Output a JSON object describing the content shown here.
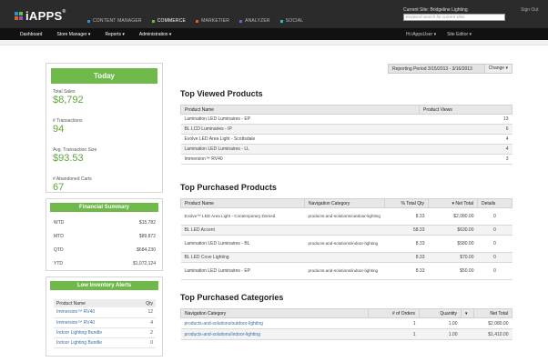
{
  "header": {
    "logo_text": "iAPPS",
    "logo_mark": "®",
    "modules": [
      {
        "label": "CONTENT MANAGER",
        "color": "#2f8fd8",
        "active": false
      },
      {
        "label": "COMMERCE",
        "color": "#6fb84a",
        "active": true
      },
      {
        "label": "MARKETIER",
        "color": "#e0622a",
        "active": false
      },
      {
        "label": "ANALYZER",
        "color": "#8a5ab8",
        "active": false
      },
      {
        "label": "SOCIAL",
        "color": "#2fb8c8",
        "active": false
      }
    ],
    "current_site": "Current Site: Bridgeline Lighting",
    "sign_out": "Sign Out",
    "search_placeholder": "Keyword search for current sites"
  },
  "nav": {
    "items": [
      "Dashboard",
      "Store Manager ▾",
      "Reports ▾",
      "Administration ▾"
    ],
    "right_items": [
      "Hi iAppsUser ▾",
      "Site Editor ▾"
    ]
  },
  "today": {
    "title": "Today",
    "stats": [
      {
        "label": "Total Sales",
        "value": "$8,792"
      },
      {
        "label": "# Transactions",
        "value": "94"
      },
      {
        "label": "Avg. Transaction Size",
        "value": "$93.53"
      },
      {
        "label": "# Abandoned Carts",
        "value": "67"
      }
    ]
  },
  "financial_summary": {
    "title": "Financial Summary",
    "rows": [
      {
        "label": "WTD",
        "value": "$15,782"
      },
      {
        "label": "MTD",
        "value": "$89,872"
      },
      {
        "label": "QTD",
        "value": "$684,230"
      },
      {
        "label": "YTD",
        "value": "$1,072,124"
      }
    ]
  },
  "low_inventory": {
    "title": "Low Inventory Alerts",
    "columns": [
      "Product Name",
      "Qty"
    ],
    "rows": [
      {
        "name": "Immersion™ RV40",
        "qty": "12"
      },
      {
        "name": "Immersion™ RV40",
        "qty": "4"
      },
      {
        "name": "Indoor Lighting Bundle",
        "qty": "2"
      },
      {
        "name": "Indoor Lighting Bundle",
        "qty": "0"
      }
    ]
  },
  "reporting_period": {
    "text": "Reporting Period 3/15/2013 - 3/16/2013",
    "change_label": "Change ▾"
  },
  "top_viewed": {
    "title": "Top Viewed Products",
    "columns": [
      "Product Name",
      "Product Views"
    ],
    "rows": [
      {
        "name": "Lamination LED Luminaires - EP",
        "views": "13"
      },
      {
        "name": "BL LCD Luminaires - IP",
        "views": "6"
      },
      {
        "name": "Evolve LED Area Light - Scottsdale",
        "views": "4"
      },
      {
        "name": "Lamination LED Luminaires - LL",
        "views": "4"
      },
      {
        "name": "Immersion™ RV40",
        "views": "3"
      }
    ]
  },
  "top_purchased": {
    "title": "Top Purchased Products",
    "columns": [
      "Product Name",
      "Navigation Category",
      "% Total Qty",
      "▾  Net Total",
      "Details"
    ],
    "rows": [
      {
        "name": "Evolve™ LED Area Light - Contemporary Domed",
        "category": "products-and-solutions/outdoor-lighting",
        "pct": "8.33",
        "net": "$2,080.00",
        "details": "0"
      },
      {
        "name": "BL LED Accent",
        "category": "",
        "pct": "58.33",
        "net": "$630.00",
        "details": "0"
      },
      {
        "name": "Lamination LED Luminaires - BL",
        "category": "products-and-solutions/indoor-lighting",
        "pct": "8.33",
        "net": "$580.00",
        "details": "0"
      },
      {
        "name": "BL LED Cove Lighting",
        "category": "",
        "pct": "8.33",
        "net": "$70.00",
        "details": "0"
      },
      {
        "name": "Lamination LED Luminaires - EP",
        "category": "products-and-solutions/indoor-lighting",
        "pct": "8.33",
        "net": "$50.00",
        "details": "0"
      }
    ]
  },
  "top_categories": {
    "title": "Top Purchased Categories",
    "columns": [
      "Navigation Category",
      "# of Orders",
      "Quantity",
      "▾",
      "Net Total"
    ],
    "rows": [
      {
        "category": "products-and-solutions/outdoor-lighting",
        "orders": "1",
        "qty": "1.00",
        "net": "$2,080.00"
      },
      {
        "category": "products-and-solutions/indoor-lighting",
        "orders": "1",
        "qty": "1.00",
        "net": "$1,410.00"
      }
    ]
  }
}
